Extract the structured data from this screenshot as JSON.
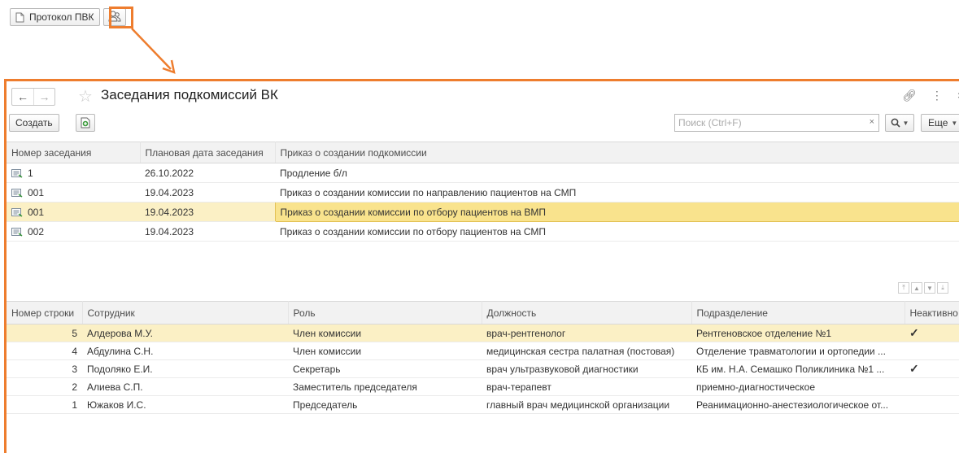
{
  "top_toolbar": {
    "protocol_button_label": "Протокол ПВК"
  },
  "window": {
    "title": "Заседания подкомиссий ВК",
    "create_label": "Создать",
    "search_placeholder": "Поиск (Ctrl+F)",
    "search_clear": "×",
    "more_label": "Еще"
  },
  "meetings": {
    "columns": [
      "Номер заседания",
      "Плановая дата заседания",
      "Приказ о создании подкомиссии"
    ],
    "rows": [
      {
        "number": "1",
        "date": "26.10.2022",
        "order": "Продление б/л"
      },
      {
        "number": "001",
        "date": "19.04.2023",
        "order": "Приказ о создании комиссии по направлению пациентов на СМП"
      },
      {
        "number": "001",
        "date": "19.04.2023",
        "order": "Приказ о создании комиссии по отбору пациентов на ВМП"
      },
      {
        "number": "002",
        "date": "19.04.2023",
        "order": "Приказ о создании комиссии по отбору пациентов на СМП"
      }
    ]
  },
  "members": {
    "columns": [
      "Номер строки",
      "Сотрудник",
      "Роль",
      "Должность",
      "Подразделение",
      "Неактивно"
    ],
    "rows": [
      {
        "line": "5",
        "employee": "Алдерова М.У.",
        "role": "Член комиссии",
        "position": "врач-рентгенолог",
        "department": "Рентгеновское отделение №1",
        "inactive": "✓"
      },
      {
        "line": "4",
        "employee": "Абдулина С.Н.",
        "role": "Член комиссии",
        "position": "медицинская сестра палатная (постовая)",
        "department": "Отделение травматологии и ортопедии ...",
        "inactive": ""
      },
      {
        "line": "3",
        "employee": "Подоляко Е.И.",
        "role": "Секретарь",
        "position": "врач ультразвуковой диагностики",
        "department": "КБ им. Н.А. Семашко Поликлиника №1 ...",
        "inactive": "✓"
      },
      {
        "line": "2",
        "employee": "Алиева С.П.",
        "role": "Заместитель председателя",
        "position": "врач-терапевт",
        "department": "приемно-диагностическое",
        "inactive": ""
      },
      {
        "line": "1",
        "employee": "Южаков И.С.",
        "role": "Председатель",
        "position": "главный врач медицинской организации",
        "department": "Реанимационно-анестезиологическое от...",
        "inactive": ""
      }
    ]
  },
  "colors": {
    "highlight": "#ee7d2e",
    "selected_row": "#fbf0c5",
    "check": "#3c9a3c"
  }
}
